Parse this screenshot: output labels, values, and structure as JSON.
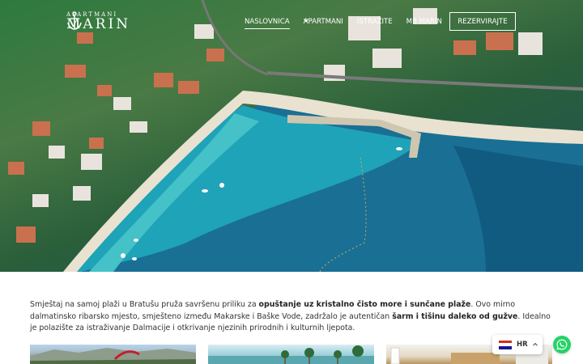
{
  "header": {
    "logo_small": "APARTMANI",
    "logo_big": "MARIN",
    "nav": [
      {
        "label": "NASLOVNICA"
      },
      {
        "label": "APARTMANI"
      },
      {
        "label": "ISTRAŽITE"
      },
      {
        "label": "MB MARIN"
      }
    ],
    "cta_label": "REZERVIRAJTE"
  },
  "intro": {
    "p1": "Smještaj na samoj plaži u Bratušu pruža savršenu priliku za ",
    "b1": "opuštanje uz kristalno čisto more i sunčane plaže",
    "p2": ". Ovo mirno dalmatinsko ribarsko mjesto, smješteno između Makarske i Baške Vode, zadržalo je autentičan ",
    "b2": "šarm i tišinu daleko od gužve",
    "p3": ". Idealno je polazište za istraživanje Dalmacije i otkrivanje njezinih prirodnih i kulturnih ljepota."
  },
  "language": {
    "code": "HR"
  },
  "colors": {
    "whatsapp": "#25d366",
    "sea": "#1f82a8",
    "flag_red": "#d52b1e",
    "flag_blue": "#171796"
  },
  "icons": {
    "logo": "anchor-icon",
    "dropdown": "chevron-down-icon",
    "chat": "whatsapp-icon",
    "lang_flag": "croatia-flag-icon",
    "lang_caret": "chevron-up-icon"
  }
}
